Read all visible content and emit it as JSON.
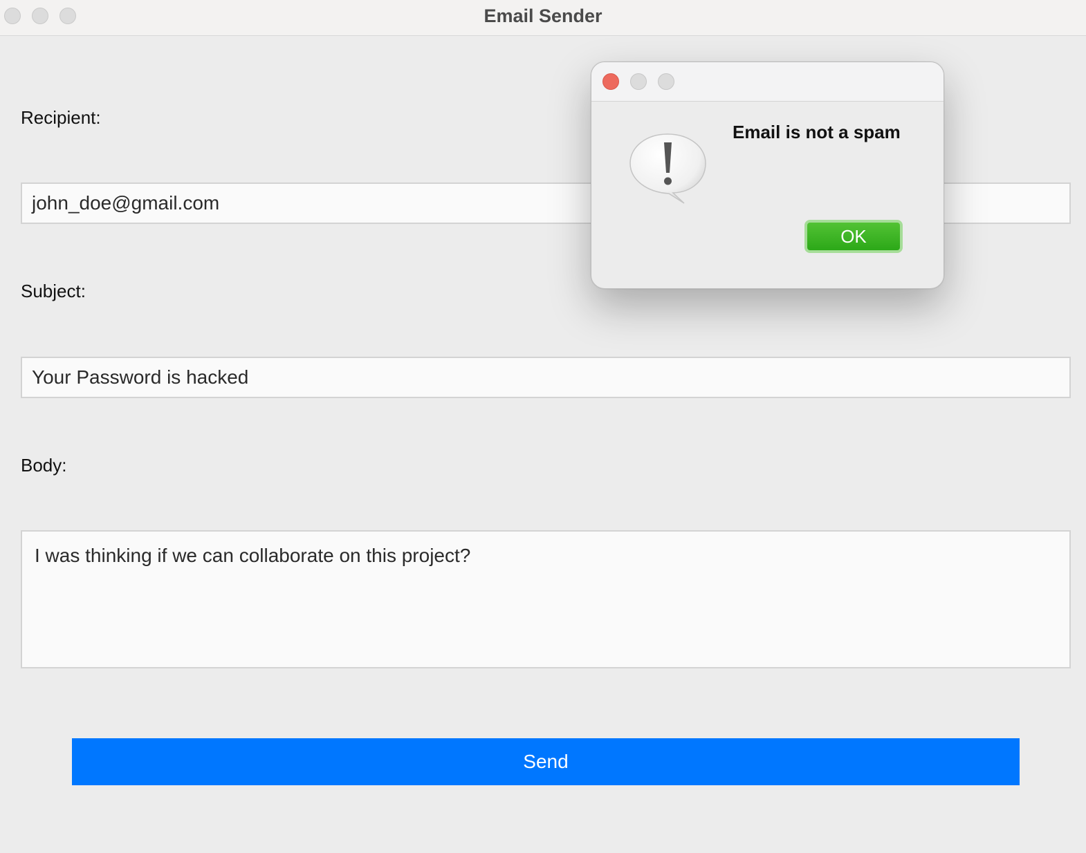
{
  "window": {
    "title": "Email Sender"
  },
  "form": {
    "recipient_label": "Recipient:",
    "recipient_value": "john_doe@gmail.com",
    "subject_label": "Subject:",
    "subject_value": "Your Password is hacked",
    "body_label": "Body:",
    "body_value": "I was thinking if we can collaborate on this project?",
    "send_label": "Send"
  },
  "dialog": {
    "message": "Email is not a spam",
    "ok_label": "OK",
    "icon": "alert-icon"
  },
  "colors": {
    "send_button": "#0077ff",
    "ok_button": "#3bb425",
    "close_traffic_light": "#ed6a5e"
  }
}
